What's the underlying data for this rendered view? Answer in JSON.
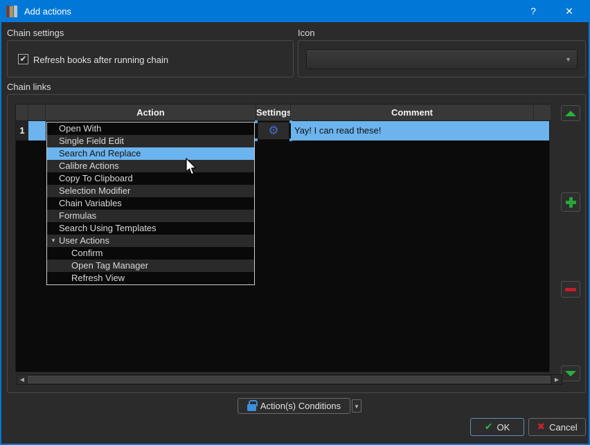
{
  "window": {
    "title": "Add actions",
    "help": "?",
    "close": "✕"
  },
  "chain_settings": {
    "section_label": "Chain settings",
    "refresh_checkbox_label": "Refresh books after running chain",
    "checkbox_checked": true,
    "check_glyph": "✔"
  },
  "icon_section": {
    "section_label": "Icon",
    "combobox_value": ""
  },
  "chain_links": {
    "section_label": "Chain links",
    "table": {
      "columns": {
        "action": "Action",
        "settings": "Settings",
        "comment": "Comment"
      },
      "rows": [
        {
          "number": "1",
          "settings_icon": "gear-icon",
          "gear_glyph": "⚙",
          "comment": "Yay! I can read these!"
        }
      ]
    },
    "action_dropdown": {
      "selected_item": "Search And Replace",
      "items": [
        {
          "label": "Open With"
        },
        {
          "label": "Single Field Edit"
        },
        {
          "label": "Search And Replace",
          "selected": true
        },
        {
          "label": "Calibre Actions"
        },
        {
          "label": "Copy To Clipboard"
        },
        {
          "label": "Selection Modifier"
        },
        {
          "label": "Chain Variables"
        },
        {
          "label": "Formulas"
        },
        {
          "label": "Search Using Templates"
        },
        {
          "label": "User Actions",
          "expanded": true,
          "expand_glyph": "▼"
        },
        {
          "label": "Confirm",
          "child": true
        },
        {
          "label": "Open Tag Manager",
          "child": true
        },
        {
          "label": "Refresh View",
          "child": true
        }
      ]
    },
    "side_buttons": {
      "move_up": "move-up-icon",
      "add": "add-icon",
      "remove": "remove-icon",
      "move_down": "move-down-icon"
    },
    "scrollbar": {
      "left_arrow": "◀",
      "right_arrow": "▶"
    }
  },
  "footer": {
    "conditions_label": "Action(s) Conditions",
    "conditions_menu_arrow": "▼",
    "ok_label": "OK",
    "ok_glyph": "✔",
    "cancel_label": "Cancel",
    "cancel_glyph": "✖"
  },
  "colors": {
    "titlebar_blue": "#0078d7",
    "selection_blue": "#6cb4ee",
    "accent_green": "#25b33a",
    "accent_red": "#c01f2a",
    "gear_blue": "#4668cf",
    "lock_blue": "#3d8fe0",
    "dialog_bg": "#2b2b2b",
    "table_bg": "#0b0b0b"
  }
}
